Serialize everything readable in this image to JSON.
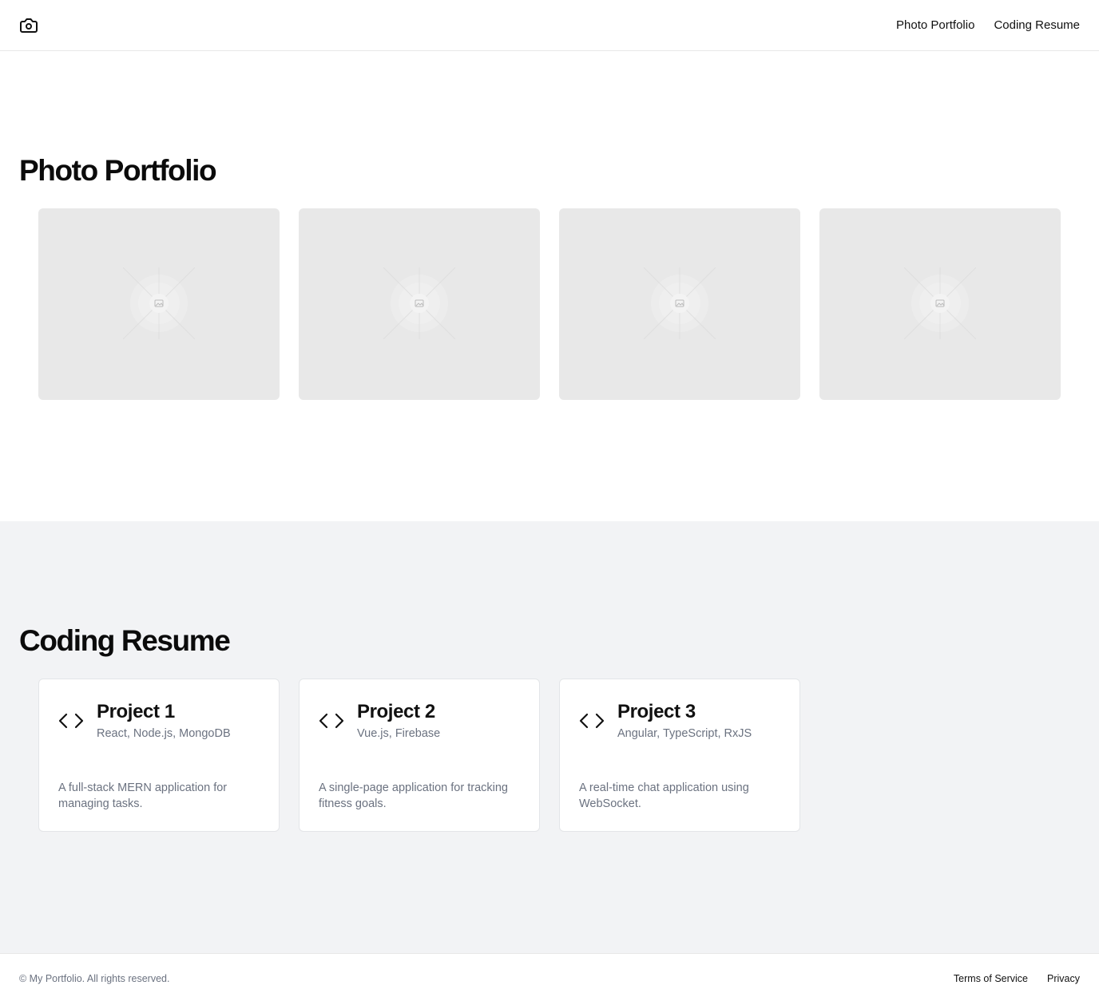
{
  "header": {
    "logo_icon": "camera-icon",
    "nav": [
      {
        "label": "Photo Portfolio"
      },
      {
        "label": "Coding Resume"
      }
    ]
  },
  "photo_portfolio": {
    "title": "Photo Portfolio",
    "placeholder_icon": "image-placeholder-icon",
    "photo_count": 4
  },
  "coding_resume": {
    "title": "Coding Resume",
    "code_icon": "code-icon",
    "projects": [
      {
        "title": "Project 1",
        "tech": "React, Node.js, MongoDB",
        "description": "A full-stack MERN application for managing tasks."
      },
      {
        "title": "Project 2",
        "tech": "Vue.js, Firebase",
        "description": "A single-page application for tracking fitness goals."
      },
      {
        "title": "Project 3",
        "tech": "Angular, TypeScript, RxJS",
        "description": "A real-time chat application using WebSocket."
      }
    ]
  },
  "footer": {
    "copyright": "© My Portfolio. All rights reserved.",
    "links": [
      {
        "label": "Terms of Service"
      },
      {
        "label": "Privacy"
      }
    ]
  },
  "colors": {
    "coding_section_bg": "#f2f3f5",
    "photo_placeholder_bg": "#e8e8e8",
    "muted_text": "#6b7280"
  }
}
